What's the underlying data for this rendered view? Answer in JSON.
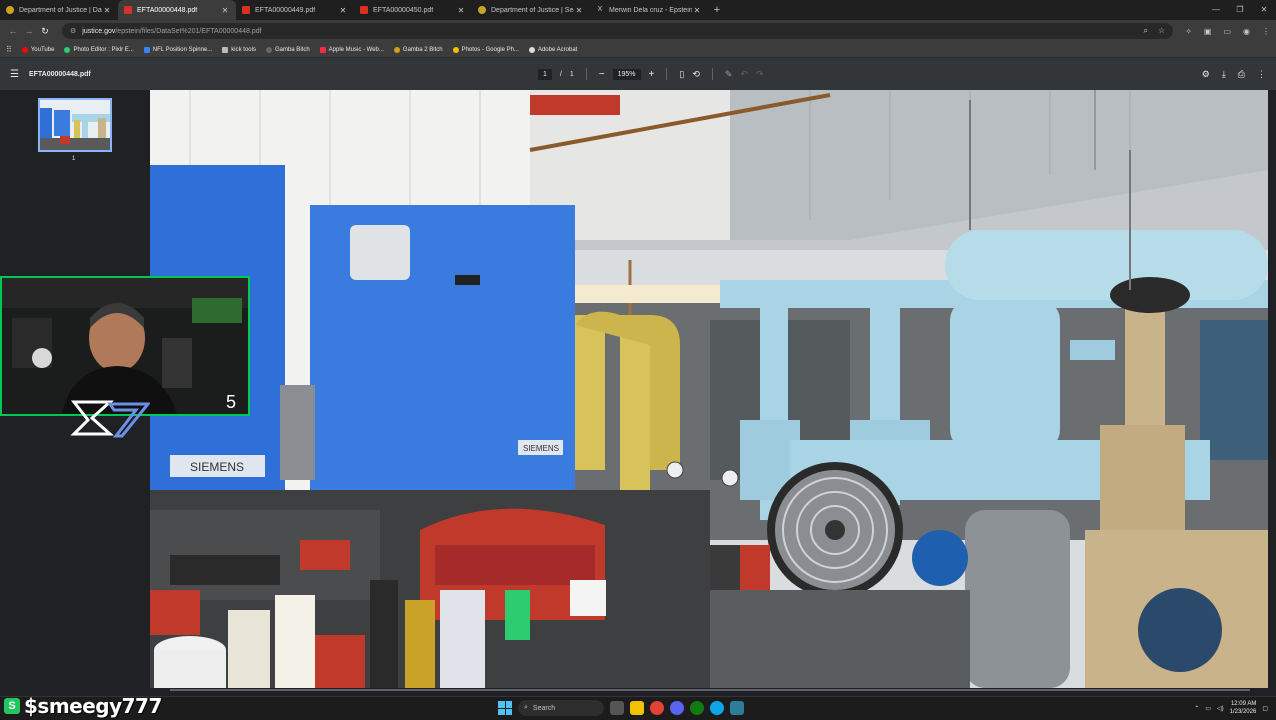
{
  "browser": {
    "tabs": [
      {
        "label": "Department of Justice | Data Se",
        "favicon": "doj-seal-icon",
        "active": false
      },
      {
        "label": "EFTA00000448.pdf",
        "favicon": "pdf-icon",
        "active": true
      },
      {
        "label": "EFTA00000449.pdf",
        "favicon": "pdf-icon",
        "active": false
      },
      {
        "label": "EFTA00000450.pdf",
        "favicon": "pdf-icon",
        "active": false
      },
      {
        "label": "Department of Justice | Search",
        "favicon": "doj-seal-icon",
        "active": false
      },
      {
        "label": "Merwin Dela cruz - Epstein We",
        "favicon": "x-icon",
        "active": false
      }
    ],
    "url": {
      "host": "justice.gov",
      "path": "/epstein/files/DataSet%201/EFTA00000448.pdf"
    },
    "bookmarks": [
      "YouTube",
      "Photo Editor : Pixlr E...",
      "NFL Position Spinne...",
      "kick tools",
      "Gamba Bitch",
      "Apple Music - Web...",
      "Gamba 2 Bitch",
      "Photos - Google Ph...",
      "Adobe Acrobat"
    ]
  },
  "pdf_viewer": {
    "filename": "EFTA00000448.pdf",
    "page_current": "1",
    "page_separator": "/",
    "page_total": "1",
    "zoom": "195%",
    "thumbnail_label": "1"
  },
  "photo": {
    "signs": [
      "SIEMENS",
      "SIEMENS"
    ]
  },
  "overlay": {
    "webcam_counter": "5",
    "streamer_name": "$smeegy777",
    "streamer_icon": "S"
  },
  "taskbar": {
    "search_placeholder": "Search",
    "time": "12:09 AM",
    "date": "1/23/2026"
  },
  "colors": {
    "accent": "#8ab4f8",
    "webcam_border": "#00c853",
    "cabinet_blue": "#2f6fd8",
    "pipe_blue": "#a8d4e6",
    "pipe_yellow": "#d8c35a"
  }
}
